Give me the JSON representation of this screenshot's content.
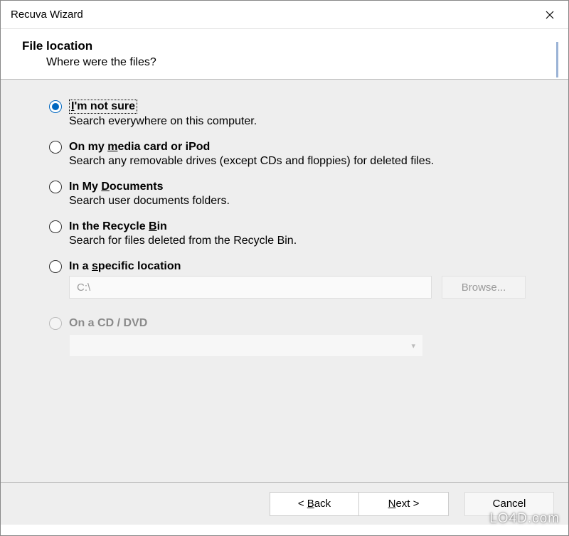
{
  "window": {
    "title": "Recuva Wizard"
  },
  "header": {
    "title": "File location",
    "subtitle": "Where were the files?"
  },
  "options": [
    {
      "label_pre": "",
      "label_ul": "I",
      "label_post": "'m not sure",
      "desc": "Search everywhere on this computer.",
      "selected": true,
      "focused": true
    },
    {
      "label_pre": "On my ",
      "label_ul": "m",
      "label_post": "edia card or iPod",
      "desc": "Search any removable drives (except CDs and floppies) for deleted files."
    },
    {
      "label_pre": "In My ",
      "label_ul": "D",
      "label_post": "ocuments",
      "desc": "Search user documents folders."
    },
    {
      "label_pre": "In the Recycle ",
      "label_ul": "B",
      "label_post": "in",
      "desc": "Search for files deleted from the Recycle Bin."
    },
    {
      "label_pre": "In a ",
      "label_ul": "s",
      "label_post": "pecific location"
    }
  ],
  "specific": {
    "path": "C:\\",
    "browse": "Browse..."
  },
  "dvd": {
    "label_pre": "On a ",
    "label_ul": "C",
    "label_post": "D / DVD",
    "disabled": true
  },
  "footer": {
    "back_pre": "< ",
    "back_ul": "B",
    "back_post": "ack",
    "next_ul": "N",
    "next_post": "ext >",
    "cancel": "Cancel"
  },
  "watermark": "LO4D.com"
}
